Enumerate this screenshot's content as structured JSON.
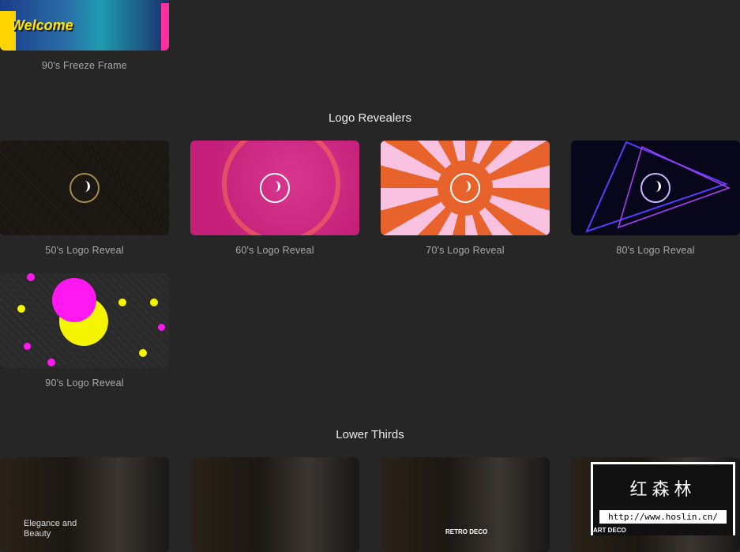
{
  "top_item": {
    "label": "90's Freeze Frame",
    "thumb_text": "Welcome"
  },
  "sections": [
    {
      "title": "Logo Revealers",
      "items": [
        {
          "label": "50's Logo Reveal"
        },
        {
          "label": "60's Logo Reveal"
        },
        {
          "label": "70's Logo Reveal"
        },
        {
          "label": "80's Logo Reveal"
        },
        {
          "label": "90's Logo Reveal"
        }
      ]
    },
    {
      "title": "Lower Thirds",
      "items": [
        {
          "thumb_text": "Elegance and Beauty"
        },
        {
          "thumb_text": ""
        },
        {
          "thumb_text": "RETRO DECO"
        },
        {
          "thumb_text": "ART DECO"
        }
      ]
    }
  ],
  "watermark": {
    "title": "红森林",
    "url": "http://www.hoslin.cn/"
  }
}
